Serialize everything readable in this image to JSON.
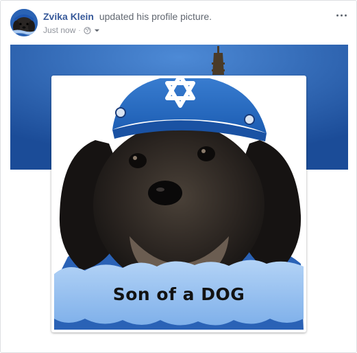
{
  "post": {
    "author": "Zvika Klein",
    "action": "updated his profile picture.",
    "timestamp": "Just now",
    "separator": "·",
    "audience_icon": "globe-icon",
    "audience_caret_icon": "chevron-down-icon",
    "menu_icon": "more-options-icon"
  },
  "media": {
    "caption": "Son of a DOG"
  },
  "colors": {
    "link": "#365899",
    "meta": "#90949c",
    "cover_blue": "#2a66b8",
    "kippah_blue": "#2c6cc4",
    "banner_blue": "#8fb9ee"
  }
}
